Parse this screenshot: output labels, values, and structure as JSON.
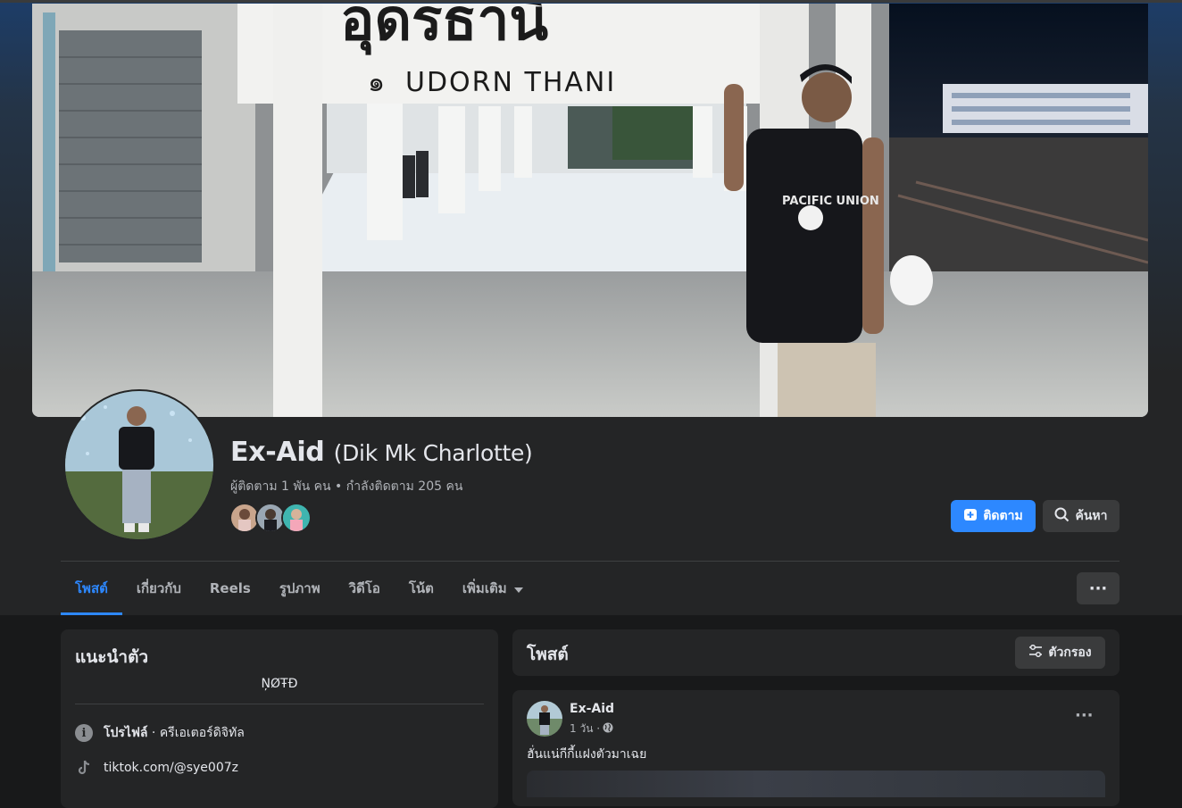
{
  "profile": {
    "name": "Ex-Aid",
    "alternate_name": "(Dik Mk Charlotte)",
    "follow_stats": "ผู้ติดตาม 1 พัน คน • กำลังติดตาม 205 คน"
  },
  "cover": {
    "sign_text": "UDORN THANI",
    "sign_prefix": "๑"
  },
  "actions": {
    "follow_label": "ติดตาม",
    "search_label": "ค้นหา",
    "more_label": "···"
  },
  "tabs": [
    {
      "label": "โพสต์",
      "active": true
    },
    {
      "label": "เกี่ยวกับ"
    },
    {
      "label": "Reels"
    },
    {
      "label": "รูปภาพ"
    },
    {
      "label": "วิดีโอ"
    },
    {
      "label": "โน้ต"
    },
    {
      "label": "เพิ่มเติม"
    }
  ],
  "intro": {
    "title": "แนะนำตัว",
    "bio": "ŅØŦĐ",
    "profile_type_label": "โปรไฟล์",
    "profile_type_value": " · ครีเอเตอร์ดิจิทัล",
    "link": "tiktok.com/@sye007z"
  },
  "posts_section": {
    "title": "โพสต์",
    "filter_label": "ตัวกรอง"
  },
  "post": {
    "author": "Ex-Aid",
    "time": "1 วัน ·",
    "text": "ฮั่นแน่กีกี้แฝงตัวมาเฉย",
    "more_label": "···"
  },
  "colors": {
    "accent": "#2d88ff",
    "background": "#18191a",
    "card": "#242526",
    "button_gray": "#3a3b3c"
  },
  "icons": [
    "follow-plus-icon",
    "search-icon",
    "chevron-down-icon",
    "info-icon",
    "tiktok-icon",
    "filter-icon",
    "globe-icon",
    "more-icon"
  ]
}
